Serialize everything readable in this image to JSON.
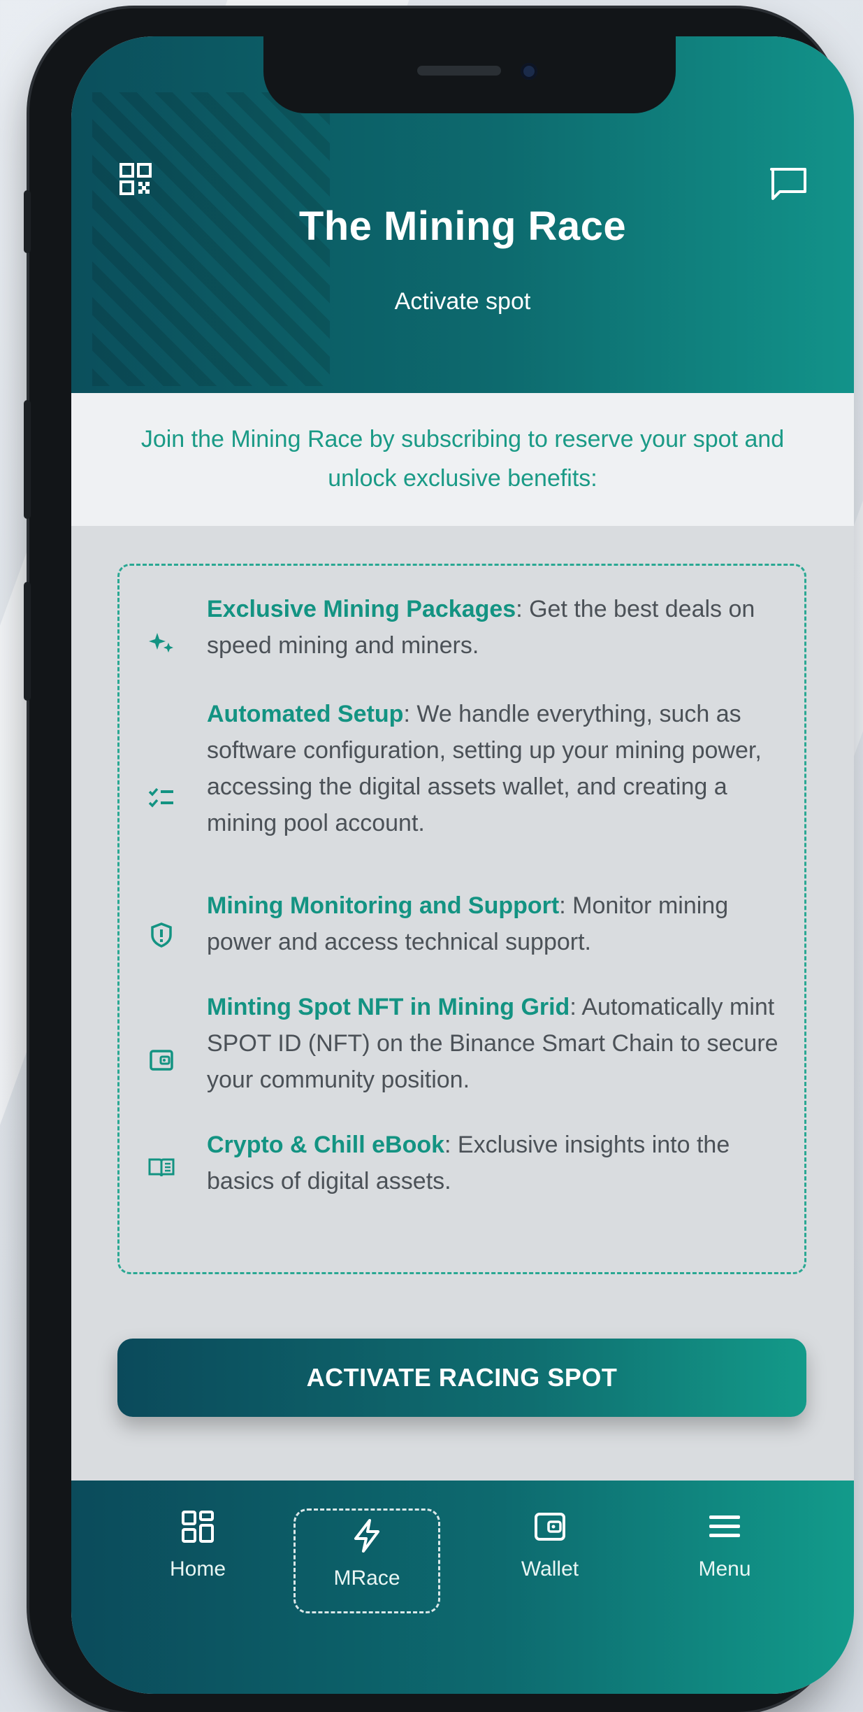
{
  "header": {
    "title": "The Mining Race",
    "subtitle": "Activate spot",
    "left_icon": "qr-code-icon",
    "right_icon": "chat-icon"
  },
  "intro": "Join the Mining Race by subscribing to reserve your spot and unlock exclusive benefits:",
  "benefits": [
    {
      "icon": "sparkle-icon",
      "title": "Exclusive Mining Packages",
      "text": ": Get the best deals on speed mining and miners."
    },
    {
      "icon": "checklist-icon",
      "title": "Automated Setup",
      "text": ": We handle everything, such as software configuration, setting up your mining power, accessing the digital assets wallet, and creating a mining pool account."
    },
    {
      "icon": "shield-icon",
      "title": "Mining Monitoring and Support",
      "text": ": Monitor mining power and access technical support."
    },
    {
      "icon": "wallet-icon",
      "title": "Minting Spot NFT in Mining Grid",
      "text": ": Automatically mint SPOT ID (NFT) on the Binance Smart Chain to secure your community position."
    },
    {
      "icon": "book-icon",
      "title": "Crypto & Chill eBook",
      "text": ": Exclusive insights into the basics of digital assets."
    }
  ],
  "cta_label": "ACTIVATE RACING SPOT",
  "tabs": [
    {
      "label": "Home",
      "icon": "grid-icon"
    },
    {
      "label": "MRace",
      "icon": "bolt-icon",
      "active": true
    },
    {
      "label": "Wallet",
      "icon": "wallet-icon"
    },
    {
      "label": "Menu",
      "icon": "hamburger-icon"
    }
  ],
  "colors": {
    "accent": "#139382",
    "header_dark": "#0b4f5c",
    "header_light": "#12938a"
  }
}
